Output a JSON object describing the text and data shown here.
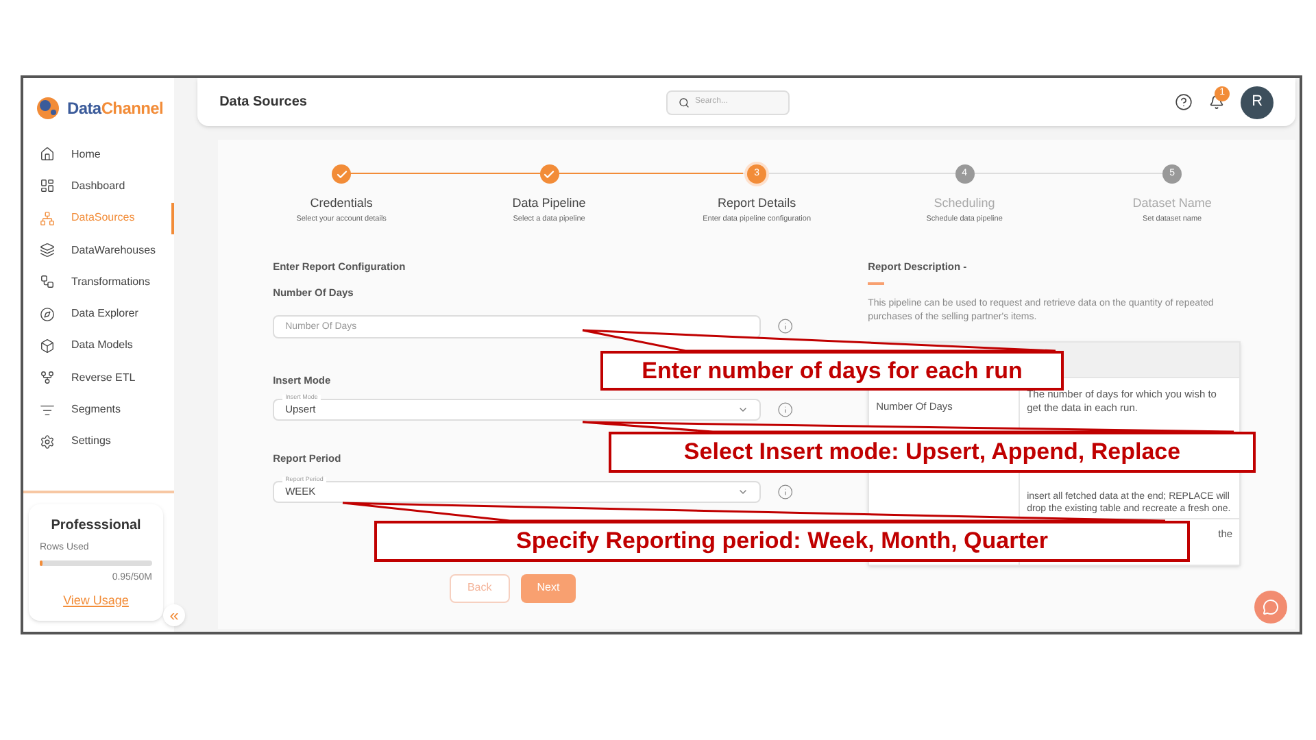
{
  "brand": {
    "name_a": "Data",
    "name_b": "Channel"
  },
  "sidebar": {
    "items": [
      {
        "label": "Home",
        "selected": false
      },
      {
        "label": "Dashboard",
        "selected": false
      },
      {
        "label": "DataSources",
        "selected": true
      },
      {
        "label": "DataWarehouses",
        "selected": false
      },
      {
        "label": "Transformations",
        "selected": false
      },
      {
        "label": "Data Explorer",
        "selected": false
      },
      {
        "label": "Data Models",
        "selected": false
      },
      {
        "label": "Reverse ETL",
        "selected": false
      },
      {
        "label": "Segments",
        "selected": false
      },
      {
        "label": "Settings",
        "selected": false
      }
    ],
    "plan": {
      "name": "Professsional",
      "rows_label": "Rows Used",
      "level": 0.02,
      "reading": "0.95/50M",
      "link": "View Usage"
    },
    "collapse": "«"
  },
  "header": {
    "title": "Data Sources",
    "search_placeholder": "Search...",
    "notifications": "1",
    "avatar": "R"
  },
  "steps": [
    {
      "completed": true,
      "active": false,
      "title": "Credentials",
      "subtitle": "Select your account details"
    },
    {
      "completed": true,
      "active": false,
      "title": "Data Pipeline",
      "subtitle": "Select a data pipeline"
    },
    {
      "completed": false,
      "active": true,
      "number": "3",
      "title": "Report Details",
      "subtitle": "Enter data pipeline configuration"
    },
    {
      "completed": false,
      "active": false,
      "number": "4",
      "title": "Scheduling",
      "subtitle": "Schedule data pipeline"
    },
    {
      "completed": false,
      "active": false,
      "number": "5",
      "title": "Dataset Name",
      "subtitle": "Set dataset name"
    }
  ],
  "form": {
    "heading": "Enter Report Configuration",
    "fields": [
      {
        "label": "Number Of Days",
        "kind": "text",
        "placeholder": "Number Of Days"
      },
      {
        "label": "Insert Mode",
        "kind": "select",
        "floating_label": "Insert Mode",
        "value": "Upsert"
      },
      {
        "label": "Report Period",
        "kind": "select",
        "floating_label": "Report Period",
        "value": "WEEK"
      }
    ],
    "buttons": [
      {
        "label": "Back",
        "kind": "secondary"
      },
      {
        "label": "Next",
        "kind": "primary"
      }
    ]
  },
  "description": {
    "heading": "Report Description -",
    "text": "This pipeline can be used to request and retrieve data on the quantity of repeated purchases of the selling partner's items.",
    "table": {
      "rows": [
        [
          "Number Of Days",
          "The number of days for which you wish to get the data in each run."
        ],
        [
          "",
          "insert all fetched data at the end; REPLACE will drop the existing table and recreate a fresh one."
        ],
        [
          "",
          "the"
        ]
      ]
    }
  },
  "callouts": [
    "Enter number of days for each run",
    "Select Insert mode: Upsert, Append, Replace",
    "Specify Reporting period: Week, Month, Quarter"
  ]
}
